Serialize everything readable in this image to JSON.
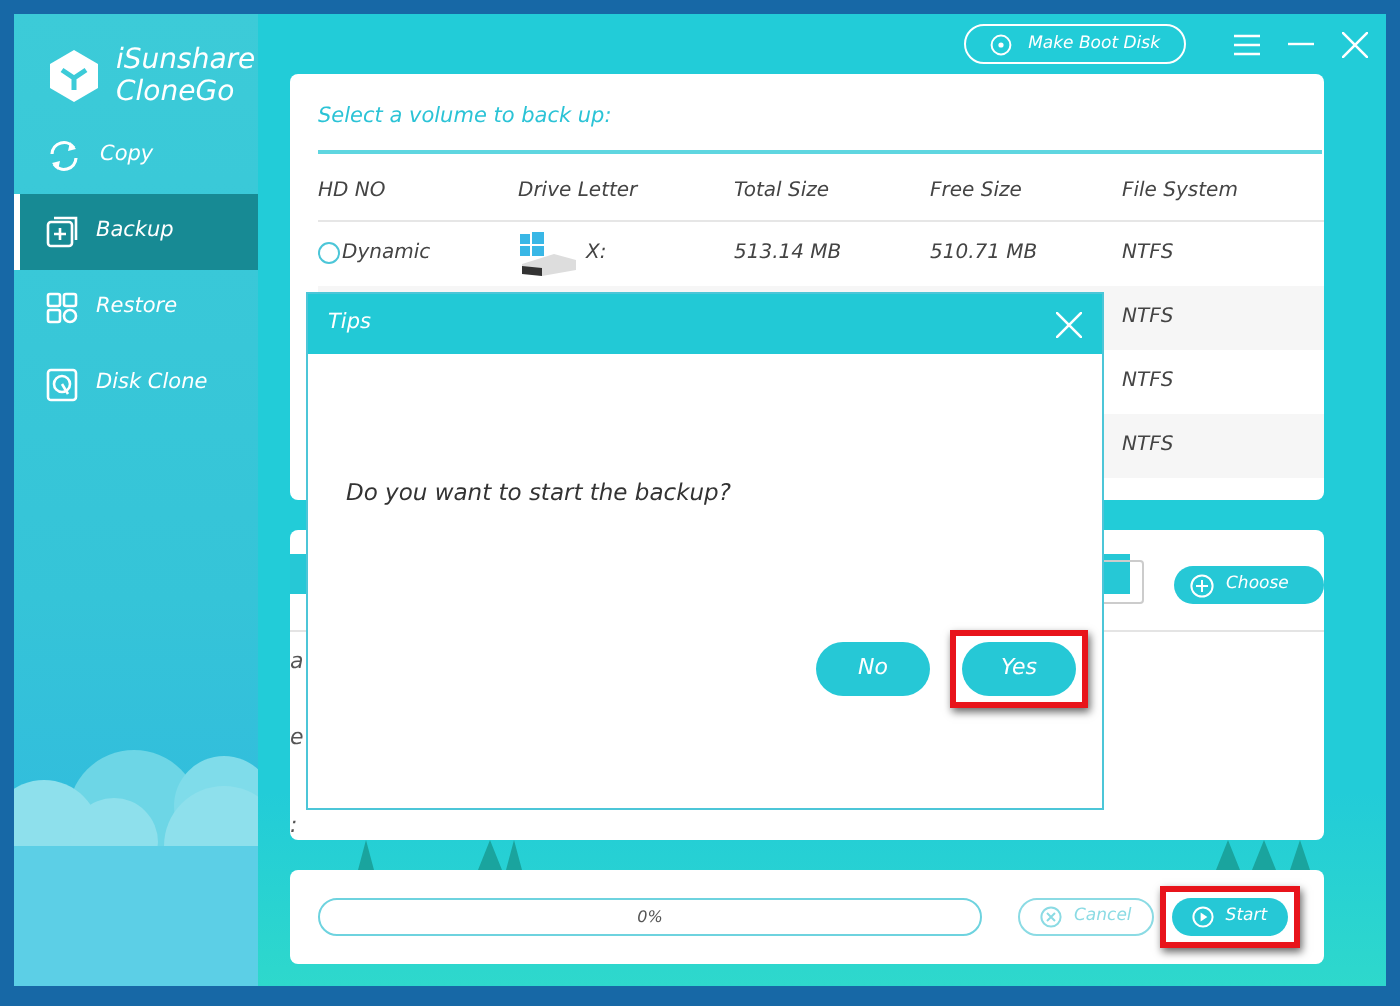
{
  "app": {
    "name_line1": "iSunshare",
    "name_line2": "CloneGo"
  },
  "sidebar": {
    "items": [
      {
        "label": "Copy",
        "kind": "copy",
        "selected": false
      },
      {
        "label": "Backup",
        "kind": "backup",
        "selected": true
      },
      {
        "label": "Restore",
        "kind": "restore",
        "selected": false
      },
      {
        "label": "Disk Clone",
        "kind": "clone",
        "selected": false
      }
    ]
  },
  "top_bar": {
    "boot_button": "Make Boot Disk"
  },
  "volume_panel": {
    "title": "Select a volume to back up:",
    "columns": [
      "HD NO",
      "Drive Letter",
      "Total Size",
      "Free Size",
      "File System"
    ],
    "rows": [
      {
        "selected": false,
        "hd_no": "Dynamic",
        "drive_letter": "X:",
        "total_size": "513.14 MB",
        "free_size": "510.71 MB",
        "file_system": "NTFS"
      },
      {
        "file_system": "NTFS"
      },
      {
        "file_system": "NTFS"
      },
      {
        "file_system": "NTFS"
      }
    ]
  },
  "target_panel": {
    "labels": [
      "a",
      "e",
      ":"
    ],
    "choose_button": "Choose"
  },
  "progress": {
    "level": 0,
    "reading": "0%"
  },
  "buttons": [
    {
      "label": "Cancel",
      "kind": "cancel",
      "disabled": true,
      "highlighted": false
    },
    {
      "label": "Start",
      "kind": "start",
      "disabled": false,
      "highlighted": true
    }
  ],
  "dialog": {
    "title": "Tips",
    "message": "Do you want to start the backup?",
    "buttons": [
      {
        "label": "No",
        "highlighted": false
      },
      {
        "label": "Yes",
        "highlighted": true
      }
    ]
  }
}
